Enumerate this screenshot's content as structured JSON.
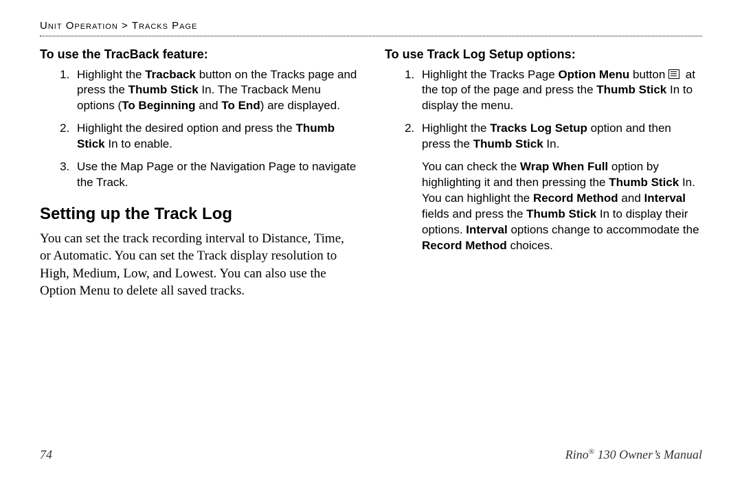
{
  "header": {
    "section": "Unit Operation",
    "sep": ">",
    "page": "Tracks Page"
  },
  "left": {
    "h1": "To use the TracBack feature:",
    "items": [
      {
        "pre": "Highlight the ",
        "b1": "Tracback",
        "mid1": " button on the Tracks page and press the ",
        "b2": "Thumb Stick",
        "mid2": " In. The Tracback Menu options (",
        "b3": "To Beginning",
        "mid3": " and ",
        "b4": "To End",
        "post": ") are displayed."
      },
      {
        "pre": "Highlight the desired option and press the ",
        "b1": "Thumb Stick",
        "post": " In to enable."
      },
      {
        "pre": "Use the Map Page or the Navigation Page to navigate the Track."
      }
    ],
    "h2": "Setting up the Track Log",
    "body": "You can set the track recording interval to Distance, Time, or Automatic. You can set the Track display resolution to High, Medium, Low, and Lowest. You can also use the Option Menu to delete all saved tracks."
  },
  "right": {
    "h1": "To use Track Log Setup options:",
    "items": [
      {
        "pre": "Highlight the Tracks Page ",
        "b1": "Option Menu",
        "mid1": " button ",
        "mid2": " at the top of the page and press the ",
        "b2": "Thumb Stick",
        "post": " In to display the menu."
      },
      {
        "pre": "Highlight the ",
        "b1": "Tracks Log Setup",
        "mid1": " option and then press the ",
        "b2": "Thumb Stick",
        "post": " In."
      }
    ],
    "para": {
      "t1": "You can check the ",
      "b1": "Wrap When Full",
      "t2": " option by highlighting it and then pressing the ",
      "b2": "Thumb Stick",
      "t3": " In. You can highlight the ",
      "b3": "Record Method",
      "t4": " and ",
      "b4": "Interval",
      "t5": " fields and press the ",
      "b5": "Thumb Stick",
      "t6": " In to display their options. ",
      "b6": "Interval",
      "t7": " options change to accommodate the ",
      "b7": "Record Method",
      "t8": " choices."
    }
  },
  "footer": {
    "pageno": "74",
    "product_pre": "Rino",
    "reg": "®",
    "product_post": " 130 Owner’s Manual"
  }
}
